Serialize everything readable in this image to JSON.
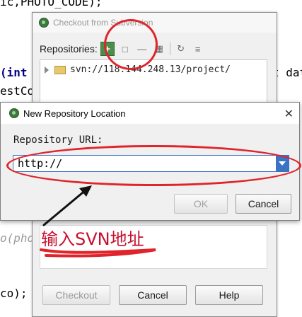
{
  "editor": {
    "line1": "ic,PHOTO_CODE);",
    "line2": "(int",
    "line2_right": "t dat",
    "line3": "estCo",
    "line4": "o(pho",
    "line5": "co);"
  },
  "checkout_dialog": {
    "title": "Checkout from Subversion",
    "toolbar_label": "Repositories:",
    "repositories": [
      "svn://118.144.248.13/project/"
    ],
    "buttons": {
      "checkout": "Checkout",
      "cancel": "Cancel",
      "help": "Help"
    }
  },
  "new_repo_dialog": {
    "title": "New Repository Location",
    "close": "✕",
    "url_label": "Repository URL:",
    "url_value": "http://",
    "ok": "OK",
    "cancel": "Cancel"
  },
  "annotation": {
    "text": "输入SVN地址",
    "color": "#e0242c"
  },
  "colors": {
    "accent": "#3b73c4",
    "add_button": "#4b8d4b"
  }
}
